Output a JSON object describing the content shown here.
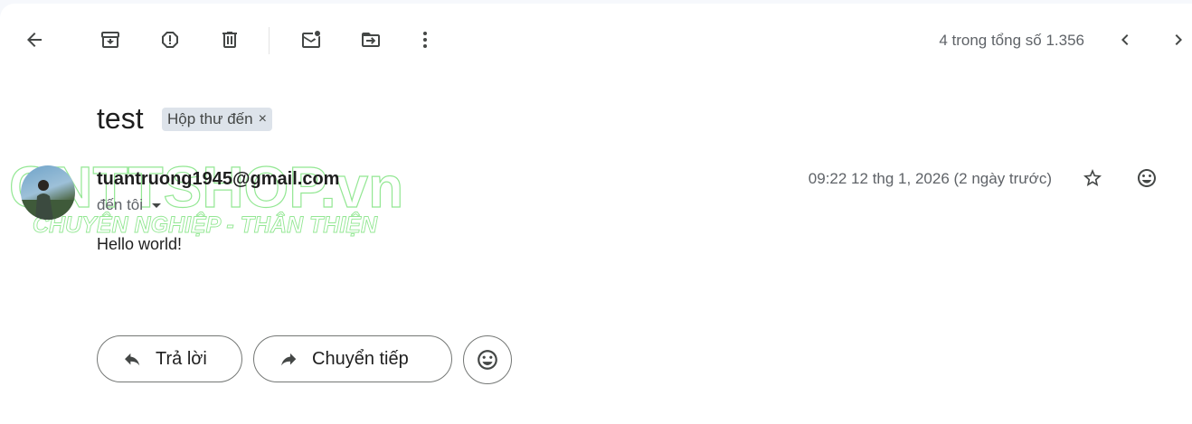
{
  "toolbar": {
    "back_icon": "arrow-back-icon",
    "archive_icon": "archive-icon",
    "report_spam_icon": "report-icon",
    "delete_icon": "trash-icon",
    "mark_unread_icon": "mark-unread-icon",
    "move_to_icon": "move-to-icon",
    "more_icon": "more-vert-icon",
    "pager_text": "4 trong tổng số 1.356",
    "prev_icon": "chevron-left-icon",
    "next_icon": "chevron-right-icon"
  },
  "message": {
    "subject": "test",
    "label": "Hộp thư đến",
    "label_remove": "×",
    "sender": "tuantruong1945@gmail.com",
    "recipients": "đến tôi",
    "date": "09:22 12 thg 1, 2026 (2 ngày trước)",
    "body": "Hello world!"
  },
  "watermark": {
    "brand": "CNTTSHOP.vn",
    "tagline": "CHUYÊN NGHIỆP - THÂN THIỆN",
    "color": "#3cd43c"
  },
  "actions": {
    "reply_label": "Trả lời",
    "forward_label": "Chuyển tiếp"
  },
  "colors": {
    "background": "#f6f8fc",
    "card": "#ffffff",
    "chip": "#dde3ea",
    "icon": "#444746",
    "secondary_text": "#5f6368"
  }
}
